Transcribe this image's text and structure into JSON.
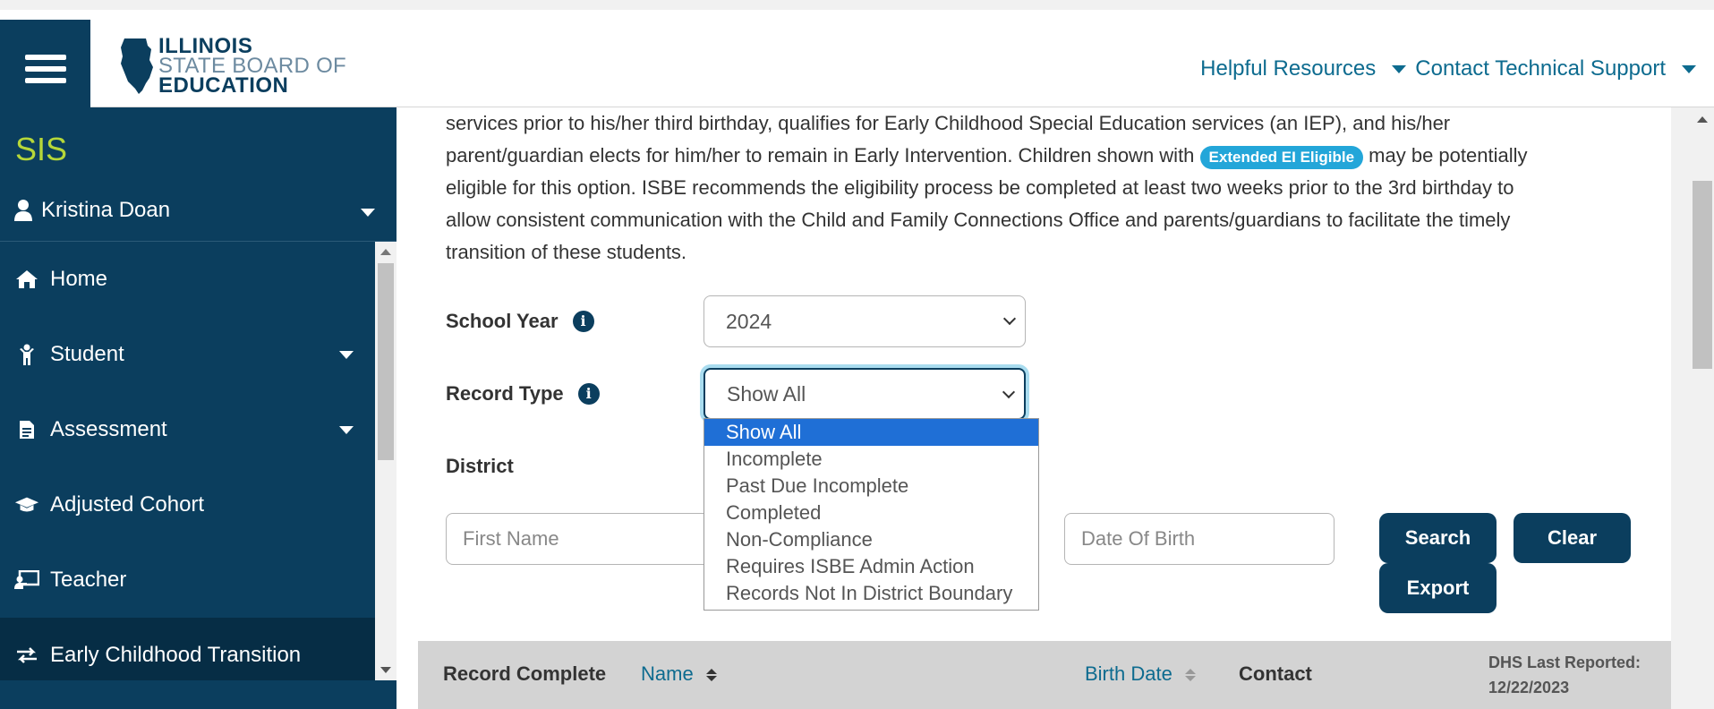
{
  "header": {
    "logo": {
      "line1": "ILLINOIS",
      "line2": "STATE BOARD OF",
      "line3": "EDUCATION"
    },
    "nav": [
      {
        "label": "Helpful Resources"
      },
      {
        "label": "Contact Technical Support"
      }
    ]
  },
  "sidebar": {
    "app_name": "SIS",
    "user_name": "Kristina Doan",
    "items": [
      {
        "label": "Home",
        "icon": "home-icon"
      },
      {
        "label": "Student",
        "icon": "student-icon"
      },
      {
        "label": "Assessment",
        "icon": "document-icon"
      },
      {
        "label": "Adjusted Cohort",
        "icon": "graduation-cap-icon"
      },
      {
        "label": "Teacher",
        "icon": "teacher-icon"
      },
      {
        "label": "Early Childhood Transition",
        "icon": "exchange-icon"
      }
    ]
  },
  "intro": {
    "line1": "services prior to his/her third birthday, qualifies for Early Childhood Special Education services (an IEP), and his/her",
    "line2_before": "parent/guardian elects for him/her to remain in Early Intervention. Children shown with",
    "badge": "Extended EI Eligible",
    "line2_after": "may be potentially",
    "line3": "eligible for this option. ISBE recommends the eligibility process be completed at least two weeks prior to the 3rd birthday to",
    "line4": "allow consistent communication with the Child and Family Connections Office and parents/guardians to facilitate the timely",
    "line5": "transition of these students."
  },
  "form": {
    "school_year_label": "School Year",
    "school_year_value": "2024",
    "record_type_label": "Record Type",
    "record_type_value": "Show All",
    "record_type_options": [
      "Show All",
      "Incomplete",
      "Past Due Incomplete",
      "Completed",
      "Non-Compliance",
      "Requires ISBE Admin Action",
      "Records Not In District Boundary"
    ],
    "district_label": "District",
    "first_name_placeholder": "First Name",
    "dob_placeholder": "Date Of Birth",
    "search_label": "Search",
    "clear_label": "Clear",
    "export_label": "Export"
  },
  "table": {
    "headers": {
      "record_complete": "Record Complete",
      "name": "Name",
      "birth_date": "Birth Date",
      "contact": "Contact"
    },
    "dhs_label": "DHS Last Reported:",
    "dhs_date": "12/22/2023"
  },
  "colors": {
    "navy": "#0b3e5e",
    "accent_link": "#0d6b8f",
    "sis_green": "#b6d739",
    "badge_blue": "#23a6d9",
    "option_highlight": "#1f6fd6"
  }
}
